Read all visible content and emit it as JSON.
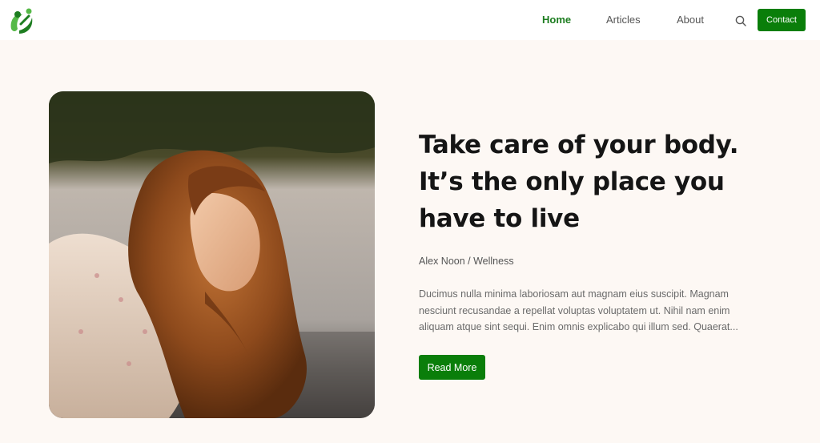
{
  "header": {
    "logo": {
      "icon": "leaf-person-logo",
      "colors": [
        "#55b947",
        "#1d7d20"
      ]
    },
    "nav": [
      {
        "label": "Home",
        "active": true
      },
      {
        "label": "Articles",
        "active": false
      },
      {
        "label": "About",
        "active": false
      }
    ],
    "search_icon": "search-icon",
    "contact_label": "Contact"
  },
  "hero": {
    "image": "woman-with-long-red-hair-by-water",
    "title_lines": [
      "Take care of your body.",
      "It’s the only place you",
      "have to live"
    ],
    "meta": "Alex Noon / Wellness",
    "excerpt_lines": [
      "Ducimus nulla minima laboriosam aut magnam eius suscipit. Magnam",
      "nesciunt recusandae a repellat voluptas voluptatem ut. Nihil nam enim",
      "aliquam atque sint sequi. Enim omnis explicabo qui illum sed. Quaerat..."
    ],
    "button_label": "Read More"
  },
  "colors": {
    "accent": "#0a7e0a",
    "page_background": "#fdf8f4",
    "header_background": "#ffffff",
    "active_nav": "#1d7d20"
  }
}
